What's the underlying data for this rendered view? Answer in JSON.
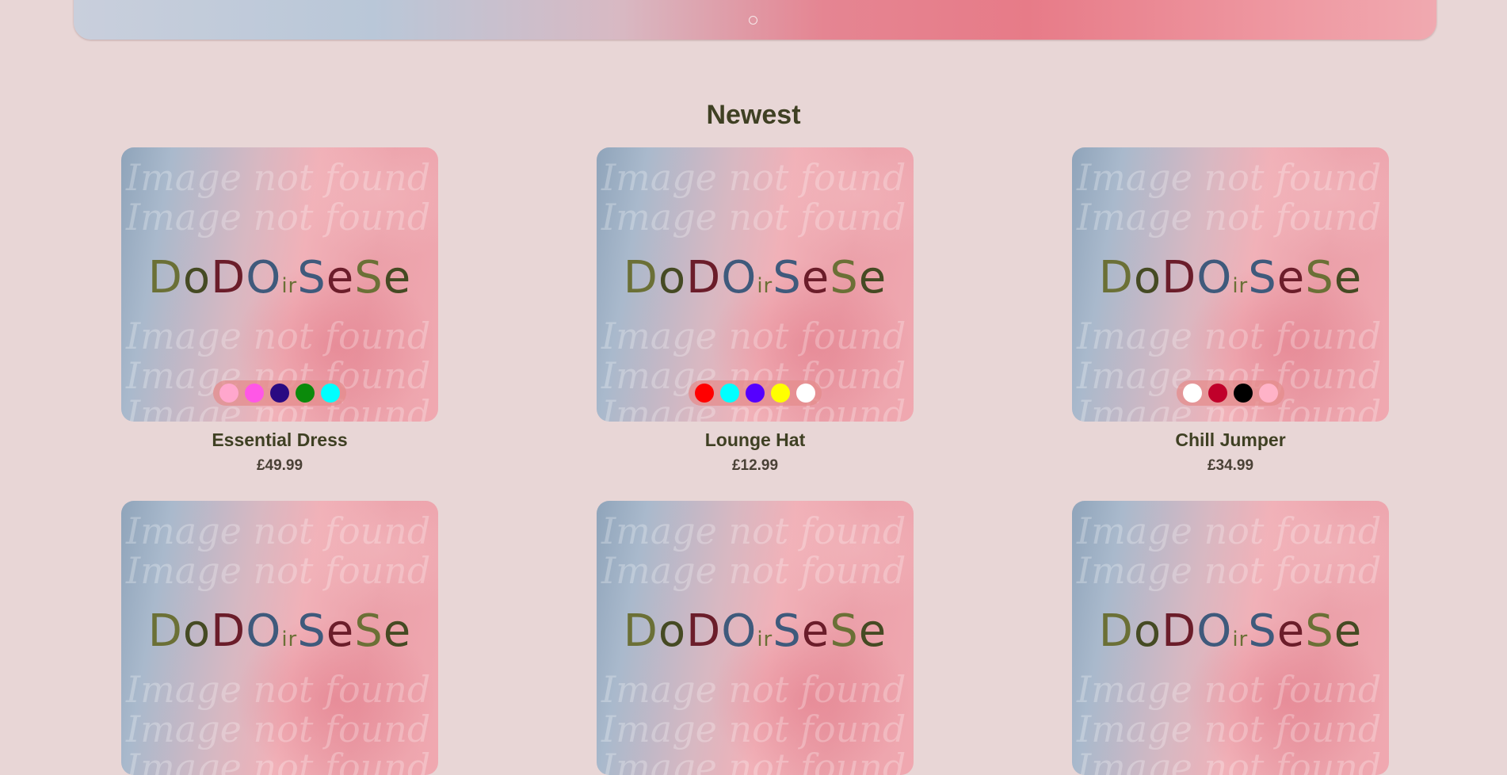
{
  "hero": {
    "dots": 1
  },
  "section": {
    "title": "Newest"
  },
  "placeholder": {
    "watermark": "Image not found",
    "logo": [
      "D",
      "o",
      "D",
      "O",
      "ir",
      "S",
      "e",
      "S",
      "e"
    ]
  },
  "products": [
    {
      "name": "Essential Dress",
      "price": "£49.99",
      "colors": [
        "#ffa7cd",
        "#ff57e6",
        "#2a0a82",
        "#0b8a0b",
        "#00ffff"
      ]
    },
    {
      "name": "Lounge Hat",
      "price": "£12.99",
      "colors": [
        "#ff0000",
        "#00ffff",
        "#5500ff",
        "#ffff00",
        "#ffffff"
      ]
    },
    {
      "name": "Chill Jumper",
      "price": "£34.99",
      "colors": [
        "#ffffff",
        "#c0002a",
        "#000000",
        "#ffb3c8"
      ]
    },
    {
      "name": "",
      "price": "",
      "colors": []
    },
    {
      "name": "",
      "price": "",
      "colors": []
    },
    {
      "name": "",
      "price": "",
      "colors": []
    }
  ]
}
